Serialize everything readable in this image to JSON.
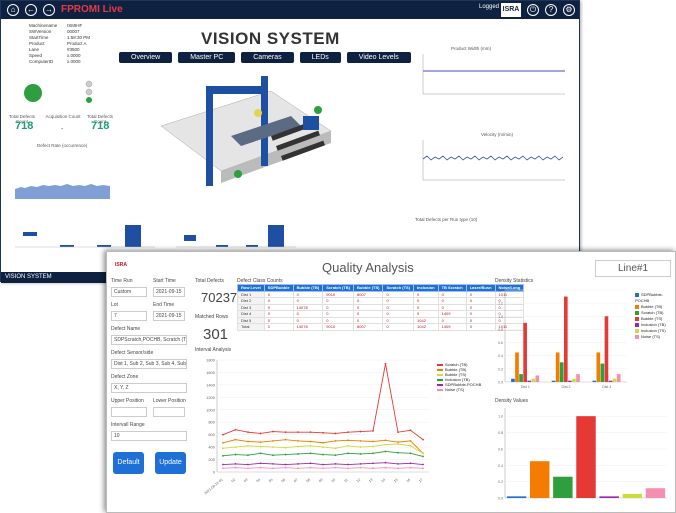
{
  "vision": {
    "brand": "FPROMI Live",
    "user_label": "Logged in as",
    "isra_label": "ISRA",
    "title": "VISION SYSTEM",
    "nav": [
      "Overview",
      "Master PC",
      "Cameras",
      "LEDs",
      "Video Levels"
    ],
    "info_rows": [
      {
        "k": "Machinename",
        "v": "ISMIHF"
      },
      {
        "k": "SWVersion",
        "v": "00007"
      },
      {
        "k": "StartTime",
        "v": "1:58:30 PM"
      },
      {
        "k": "Product",
        "v": "Product A"
      },
      {
        "k": "Lane",
        "v": "#3500"
      },
      {
        "k": "Speed",
        "v": "x.0000"
      },
      {
        "k": "ComputerID",
        "v": "x.0000"
      }
    ],
    "left_stats": [
      {
        "label": "Total Defects Count",
        "value": "718"
      },
      {
        "label": "Acquisition Count",
        "value": "-"
      },
      {
        "label": "Total Defects Count",
        "value": "718"
      }
    ],
    "defect_rate_label": "Defect Rate (occurrence)",
    "product_width_label": "Product Width (mm)",
    "velocity_label": "Velocity (m/min)",
    "total_defect_label": "Total Defects per Run type (10)",
    "foot": "VISION SYSTEM"
  },
  "quality": {
    "title": "Quality Analysis",
    "line": "Line#1",
    "logo": "ISRA",
    "fields": [
      {
        "label": "Time Run",
        "value": "Custom"
      },
      {
        "label": "Start Time",
        "value": "2021-09-15"
      },
      {
        "label": "Lot",
        "value": "7"
      },
      {
        "label": "End Time",
        "value": "2021-09-15"
      },
      {
        "label": "Defect Name",
        "value": "SDPScratch,POCHB, Scratch (TB), Bu..."
      },
      {
        "label": "Defect Sensor/side",
        "value": "Dist 1, Sub 2, Sub 3, Sub 4, Sub 5"
      },
      {
        "label": "Defect Zone",
        "value": "X, Y, Z"
      },
      {
        "label": "Upper Position",
        "value": ""
      },
      {
        "label": "Lower Position",
        "value": ""
      },
      {
        "label": "Intervall Range",
        "value": "10"
      }
    ],
    "buttons": {
      "default": "Default",
      "update": "Update"
    },
    "total_defects_label": "Total Defects",
    "total_defects": "70237",
    "matched_rows_label": "Matched Rows",
    "matched_rows": "301",
    "table_title": "Defect Class Counts",
    "table_headers": [
      "Row Level",
      "SDPBubble",
      "Bubble (TB)",
      "Scratch (TB)",
      "Bubble (TS)",
      "Scratch (TS)",
      "Inclusion",
      "TB Scratch",
      "Laser/Busn",
      "Noise/Long"
    ],
    "table_rows": [
      [
        "Dist 1",
        "0",
        "0",
        "9010",
        "8007",
        "0",
        "0",
        "0",
        "0",
        "1011"
      ],
      [
        "Dist 2",
        "0",
        "0",
        "0",
        "0",
        "0",
        "0",
        "0",
        "0",
        "0"
      ],
      [
        "Dist 3",
        "0",
        "14078",
        "0",
        "0",
        "0",
        "0",
        "0",
        "0",
        "0"
      ],
      [
        "Dist 4",
        "0",
        "0",
        "0",
        "0",
        "0",
        "0",
        "1409",
        "0",
        "0"
      ],
      [
        "Dist 5",
        "0",
        "0",
        "0",
        "0",
        "0",
        "1042",
        "0",
        "0",
        "0"
      ],
      [
        "Total",
        "0",
        "14078",
        "9010",
        "8007",
        "0",
        "1042",
        "1409",
        "0",
        "1011"
      ]
    ],
    "interval_chart_title": "Interval Analysis",
    "density_title": "Density Statistics",
    "density2_title": "Density Values",
    "legend": [
      "SDPBubble-POCHB",
      "Bubble (TB)",
      "Scratch (TB)",
      "Bubble (TS)",
      "Inclusion (TB)",
      "Inclusion (TS)",
      "Noise (TS)"
    ],
    "colors": {
      "red": "#e53935",
      "orange": "#f57c00",
      "green": "#2e9e3e",
      "pink": "#f48fb1",
      "purple": "#9c27b0",
      "yellow": "#cddc39",
      "blue": "#1e6fd6"
    }
  },
  "chart_data": [
    {
      "type": "line",
      "title": "Interval Analysis",
      "x": [
        "2021-09-15 01",
        "02",
        "03",
        "04",
        "05",
        "06",
        "07",
        "08",
        "09",
        "10",
        "11",
        "12",
        "13",
        "14",
        "15",
        "16",
        "17"
      ],
      "ylim": [
        0,
        1800
      ],
      "series": [
        {
          "name": "Scratch (TB)",
          "values": [
            600,
            680,
            640,
            620,
            650,
            640,
            640,
            640,
            630,
            620,
            640,
            650,
            660,
            1740,
            640,
            670,
            520
          ]
        },
        {
          "name": "Bubble (TB)",
          "values": [
            470,
            520,
            490,
            480,
            500,
            520,
            500,
            490,
            470,
            500,
            510,
            500,
            490,
            510,
            480,
            500,
            300
          ]
        },
        {
          "name": "Bubble (TS)",
          "values": [
            380,
            400,
            420,
            410,
            400,
            390,
            410,
            420,
            400,
            380,
            420,
            400,
            410,
            440,
            450,
            420,
            300
          ]
        },
        {
          "name": "Inclusion (TB)",
          "values": [
            260,
            280,
            270,
            300,
            270,
            280,
            290,
            300,
            280,
            270,
            300,
            290,
            300,
            330,
            310,
            300,
            250
          ]
        },
        {
          "name": "SDPBubble-POCHB",
          "values": [
            120,
            130,
            120,
            140,
            130,
            120,
            130,
            140,
            120,
            130,
            120,
            130,
            140,
            150,
            130,
            140,
            120
          ]
        },
        {
          "name": "Noise (TS)",
          "values": [
            60,
            70,
            60,
            70,
            60,
            70,
            60,
            70,
            60,
            70,
            60,
            70,
            60,
            70,
            60,
            70,
            60
          ]
        }
      ]
    },
    {
      "type": "bar",
      "title": "Density Statistics",
      "categories": [
        "Dist 1",
        "Dist 2",
        "Dist 3"
      ],
      "ylim": [
        0,
        1.4
      ],
      "series": [
        {
          "name": "SDPBubble-POCHB",
          "values": [
            0.05,
            0.02,
            0.02
          ]
        },
        {
          "name": "Bubble (TB)",
          "values": [
            0.45,
            0.45,
            0.45
          ]
        },
        {
          "name": "Scratch (TB)",
          "values": [
            0.12,
            0.3,
            0.28
          ]
        },
        {
          "name": "Bubble (TS)",
          "values": [
            0.9,
            1.3,
            1.0
          ]
        },
        {
          "name": "Inclusion (TB)",
          "values": [
            0.02,
            0.02,
            0.02
          ]
        },
        {
          "name": "Inclusion (TS)",
          "values": [
            0.05,
            0.05,
            0.05
          ]
        },
        {
          "name": "Noise (TS)",
          "values": [
            0.1,
            0.12,
            0.12
          ]
        }
      ]
    },
    {
      "type": "bar",
      "title": "Density Values",
      "categories": [
        "SDPBubble-POCHB",
        "Bubble (TB)",
        "Scratch (TB)",
        "Bubble (TS)",
        "Inclusion (TB)",
        "Inclusion (TS)",
        "Noise (TS)"
      ],
      "values": [
        0.02,
        0.45,
        0.26,
        1.0,
        0.02,
        0.05,
        0.12
      ],
      "ylim": [
        0,
        1.1
      ]
    }
  ]
}
